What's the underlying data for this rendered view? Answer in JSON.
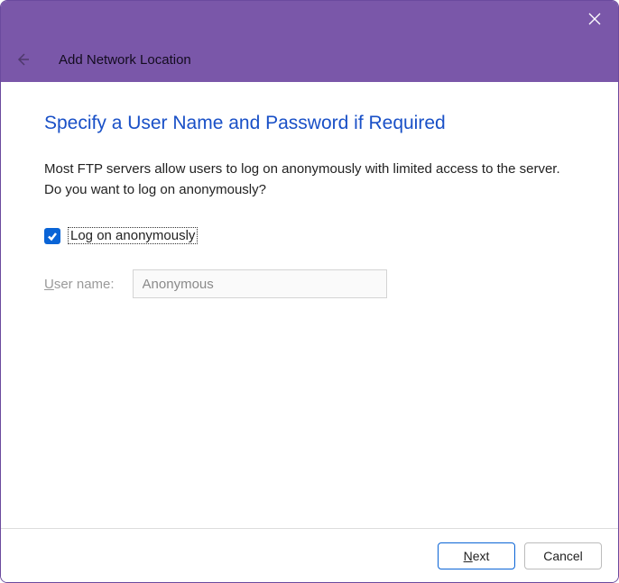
{
  "titlebar": {
    "close_label": "Close"
  },
  "header": {
    "title": "Add Network Location"
  },
  "content": {
    "heading": "Specify a User Name and Password if Required",
    "description": "Most FTP servers allow users to log on anonymously with limited access to the server.  Do you want to log on anonymously?",
    "checkbox_label": "Log on anonymously",
    "checkbox_checked": true,
    "username_label_pre": "U",
    "username_label_post": "ser name:",
    "username_value": "Anonymous"
  },
  "footer": {
    "next_pre": "N",
    "next_post": "ext",
    "cancel_label": "Cancel"
  }
}
